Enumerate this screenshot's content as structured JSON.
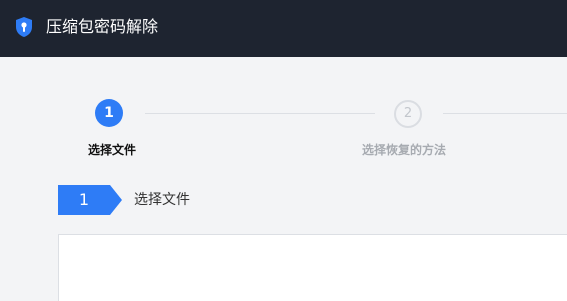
{
  "titlebar": {
    "title": "压缩包密码解除",
    "icon": "shield-key-icon",
    "background_color": "#1e2430"
  },
  "stepper": {
    "steps": [
      {
        "number": "1",
        "label": "选择文件",
        "state": "active"
      },
      {
        "number": "2",
        "label": "选择恢复的方法",
        "state": "inactive"
      }
    ],
    "active_color": "#2e7cf6"
  },
  "section": {
    "number": "1",
    "title": "选择文件"
  }
}
